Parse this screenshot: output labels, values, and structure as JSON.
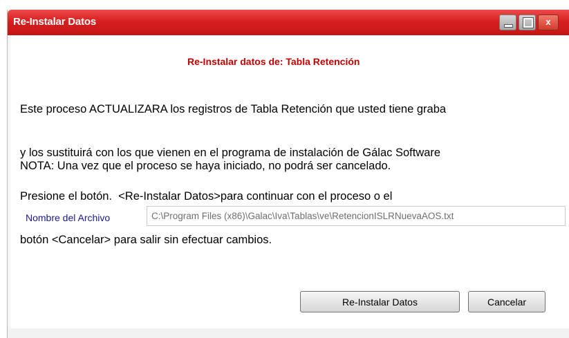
{
  "window": {
    "title": "Re-Instalar Datos",
    "controls": {
      "minimize_icon": "minimize-icon",
      "maximize_icon": "maximize-icon",
      "close_label": "x"
    }
  },
  "content": {
    "heading": "Re-Instalar datos de: Tabla Retención",
    "body_lines": [
      "Este proceso ACTUALIZARA los registros de Tabla Retención que usted tiene graba",
      "y los sustituirá con los que vienen en el programa de instalación de Gálac Software",
      "Presione el botón.  <Re-Instalar Datos>para continuar con el proceso o el",
      "botón <Cancelar> para salir sin efectuar cambios."
    ],
    "note": "NOTA: Una vez que el proceso se haya iniciado, no podrá ser cancelado.",
    "file_label": "Nombre del Archivo",
    "file_path": "C:\\Program Files (x86)\\Galac\\Iva\\Tablas\\ve\\RetencionISLRNuevaAOS.txt"
  },
  "buttons": {
    "reinstall": "Re-Instalar Datos",
    "cancel": "Cancelar"
  },
  "colors": {
    "titlebar": "#d72020",
    "heading": "#c00000",
    "label": "#1a1a8c"
  }
}
